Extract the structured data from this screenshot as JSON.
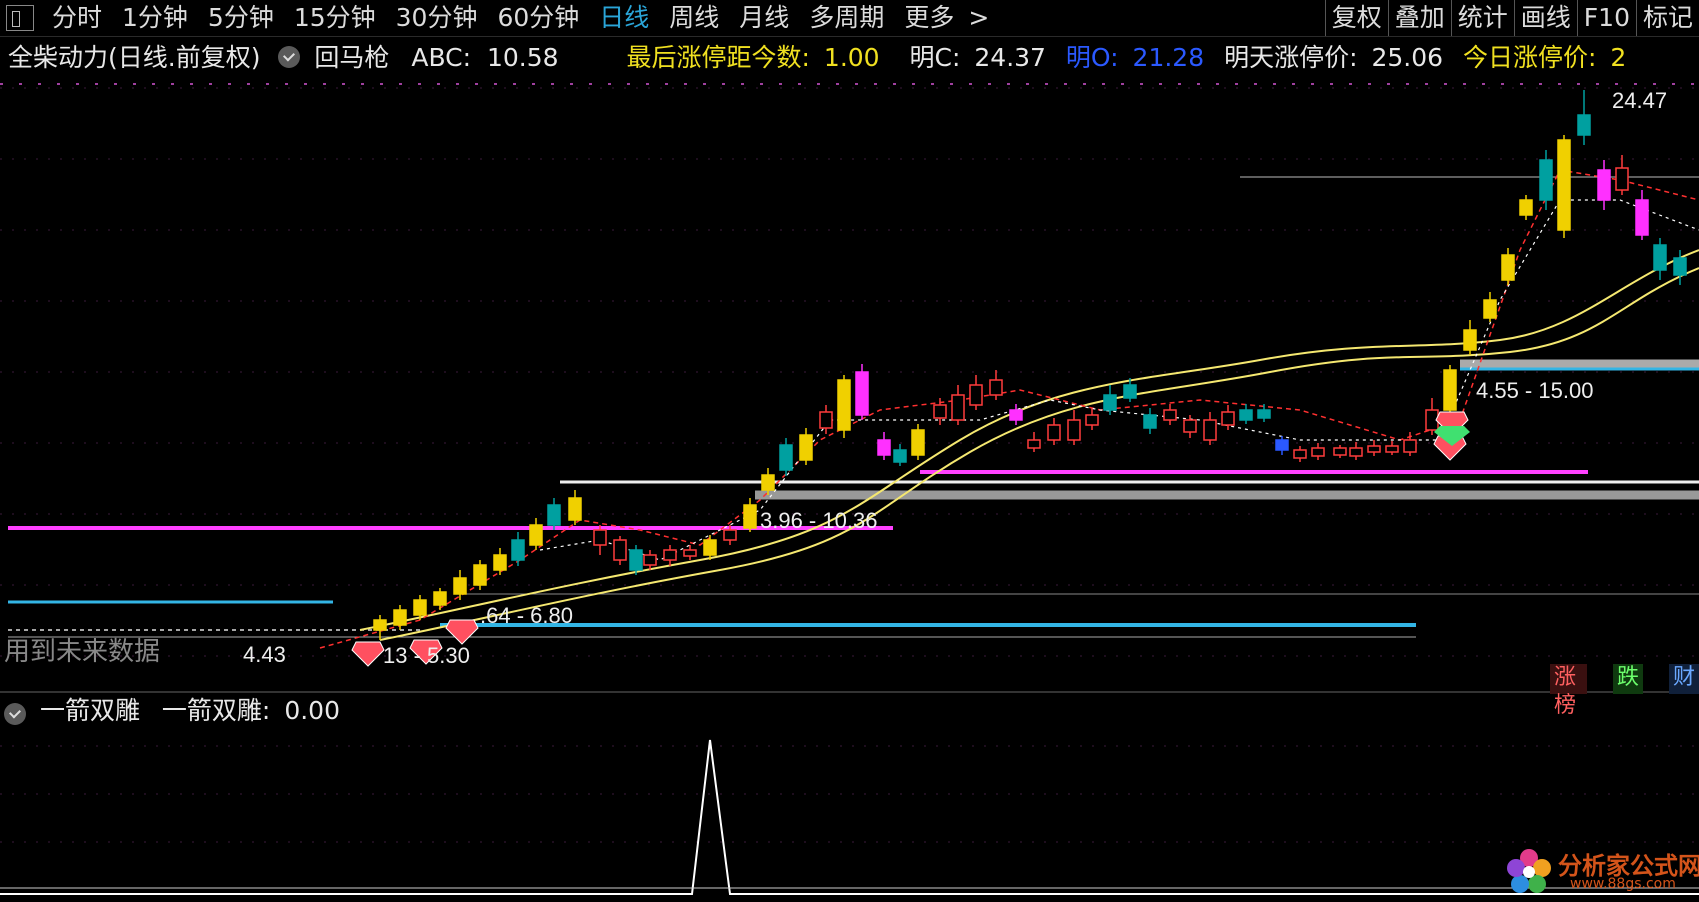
{
  "toolbar": {
    "periods": [
      "分时",
      "1分钟",
      "5分钟",
      "15分钟",
      "30分钟",
      "60分钟",
      "日线",
      "周线",
      "月线",
      "多周期",
      "更多"
    ],
    "active": "日线",
    "right": [
      "复权",
      "叠加",
      "统计",
      "画线",
      "F10",
      "标记"
    ]
  },
  "info": {
    "stock": "全柴动力(日线.前复权)",
    "indicator": "回马枪",
    "abc_label": "ABC:",
    "abc_value": "10.58",
    "last_limit_label": "最后涨停距今数:",
    "last_limit_value": "1.00",
    "mingc_label": "明C:",
    "mingc_value": "24.37",
    "mingo_label": "明O:",
    "mingo_value": "21.28",
    "tomorrow_label": "明天涨停价:",
    "tomorrow_value": "25.06",
    "today_label": "今日涨停价:",
    "today_value": "2"
  },
  "annotations": {
    "high_price": "24.47",
    "range_top": "4.55 - 15.00",
    "range_mid": "3.96 - 10.36",
    "range_low": ".64 - 6.80",
    "range_bottom": "13 - 5.30",
    "low_price": "4.43",
    "future_warning": "用到未来数据"
  },
  "sub": {
    "title": "一箭双雕",
    "label": "一箭双雕:",
    "value": "0.00"
  },
  "tags": [
    "涨榜",
    "跌",
    "财"
  ],
  "logo": {
    "name": "分析家公式网",
    "url": "www.88gs.com"
  },
  "colors": {
    "up": "#ff3c3c",
    "down": "#00aaaa",
    "yellow": "#f0e020",
    "magenta": "#ff40ff",
    "cyan": "#33b5e5",
    "white": "#ffffff",
    "blue": "#2b59ff"
  }
}
